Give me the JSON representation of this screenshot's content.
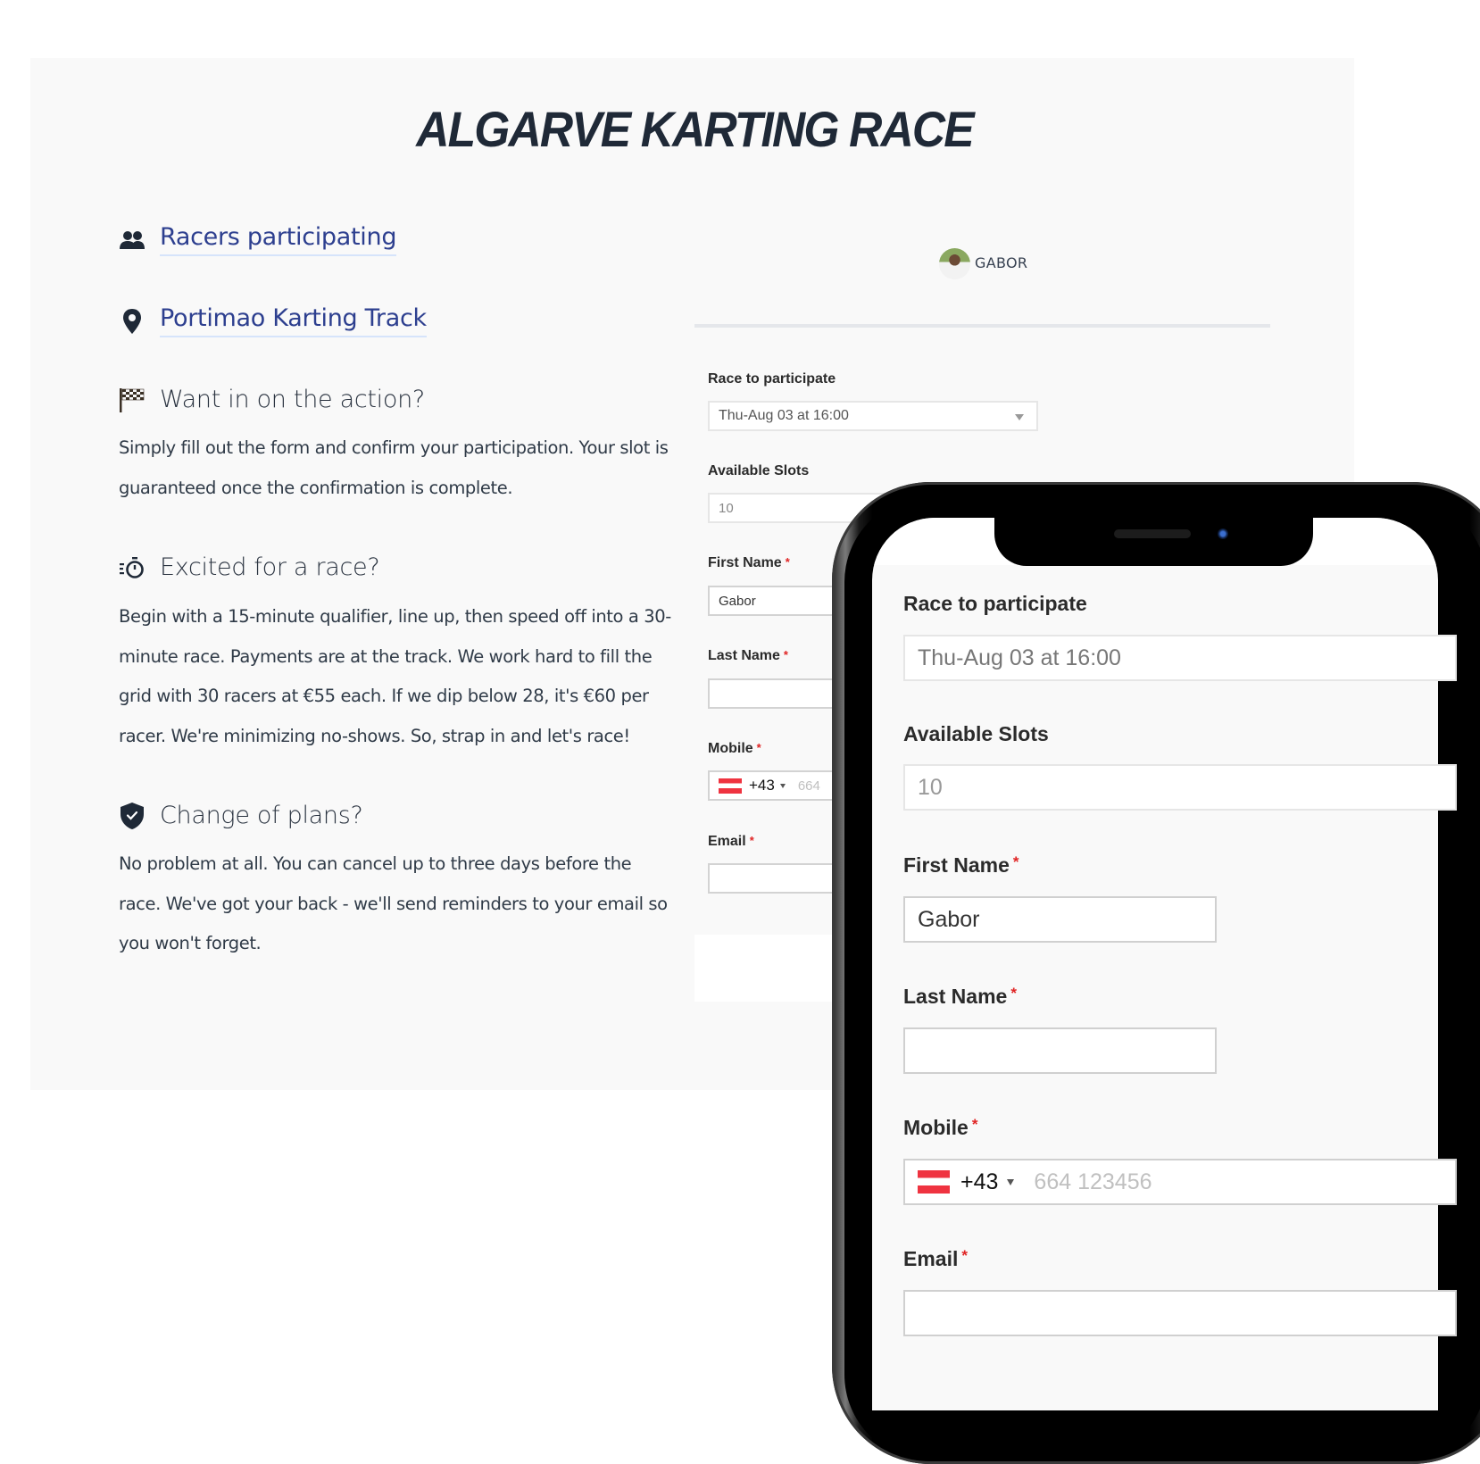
{
  "page": {
    "title": "ALGARVE KARTING RACE"
  },
  "left": {
    "links": [
      {
        "icon": "users-icon",
        "label": "Racers participating"
      },
      {
        "icon": "map-pin-icon",
        "label": "Portimao Karting Track"
      }
    ],
    "sections": [
      {
        "icon": "checkered-flag-icon",
        "heading": "Want in on the action?",
        "lines": [
          "Simply fill out the form and confirm your participation. Your slot is",
          "guaranteed once the confirmation is complete."
        ]
      },
      {
        "icon": "stopwatch-icon",
        "heading": "Excited for a race?",
        "lines": [
          "Begin with a 15-minute qualifier, line up, then speed off into a 30-",
          "minute race. Payments are at the track. We work hard to fill the",
          "grid with 30 racers at €55 each. If we dip below 28, it's €60 per",
          "racer. We're minimizing no-shows. So, strap in and let's race!"
        ]
      },
      {
        "icon": "shield-check-icon",
        "heading": "Change of plans?",
        "lines": [
          "No problem at all. You can cancel up to three days before the",
          "race. We've got your back - we'll send reminders to your email so",
          "you won't forget."
        ]
      }
    ]
  },
  "organizer": {
    "name": "GABOR"
  },
  "form": {
    "race_label": "Race to participate",
    "race_value": "Thu-Aug 03 at 16:00",
    "slots_label": "Available Slots",
    "slots_value": "10",
    "first_name_label": "First Name",
    "first_name_value": "Gabor",
    "last_name_label": "Last Name",
    "last_name_value": "",
    "mobile_label": "Mobile",
    "mobile_country_code": "+43",
    "mobile_placeholder_desktop": "664",
    "mobile_placeholder": "664 123456",
    "email_label": "Email",
    "email_value": "",
    "required_mark": "*"
  },
  "colors": {
    "link": "#2d3f8f",
    "required": "#e02424",
    "flag_red": "#ef3340"
  }
}
